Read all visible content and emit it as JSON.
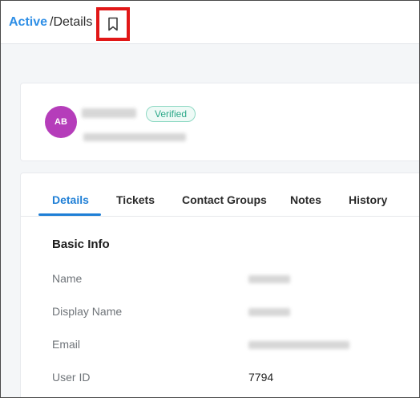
{
  "breadcrumb": {
    "parent": "Active",
    "current": "/Details"
  },
  "bookmark": {
    "icon": "bookmark-icon"
  },
  "profile": {
    "avatar_initials": "AB",
    "avatar_color": "#b53dba",
    "verified_label": "Verified"
  },
  "tabs": [
    "Details",
    "Tickets",
    "Contact Groups",
    "Notes",
    "History"
  ],
  "details": {
    "section_title": "Basic Info",
    "fields": [
      {
        "label": "Name",
        "value": ""
      },
      {
        "label": "Display Name",
        "value": ""
      },
      {
        "label": "Email",
        "value": ""
      },
      {
        "label": "User ID",
        "value": "7794"
      }
    ]
  },
  "colors": {
    "accent": "#1f7fd6",
    "breadcrumb_link": "#2d8ee6",
    "highlight_box": "#e11717",
    "verified": "#2ba888"
  }
}
